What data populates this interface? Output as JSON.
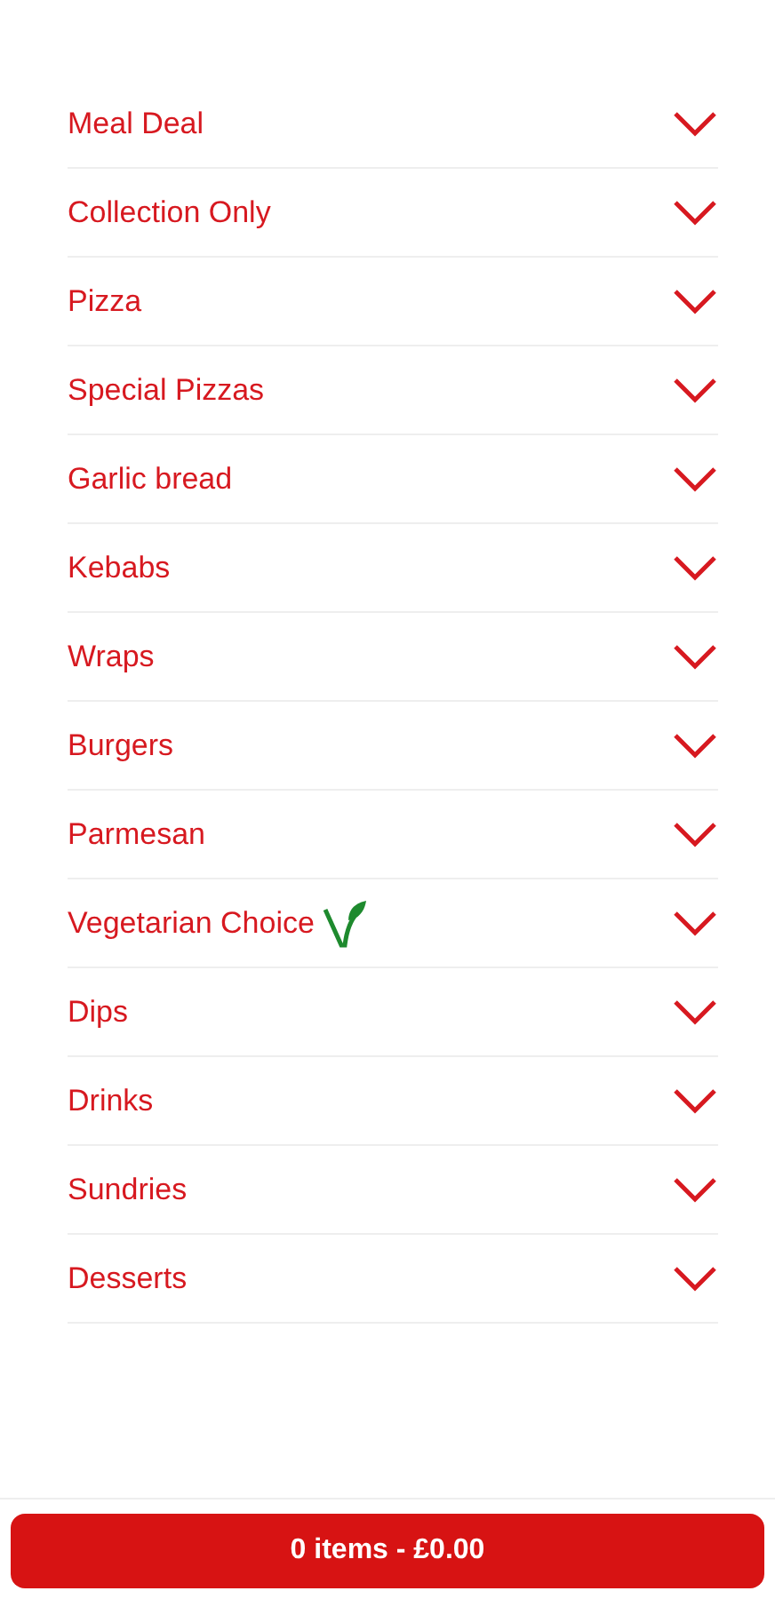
{
  "categories": [
    {
      "label": "Meal Deal",
      "vegetarian": false,
      "expanded": false
    },
    {
      "label": "Collection Only",
      "vegetarian": false,
      "expanded": false
    },
    {
      "label": "Pizza",
      "vegetarian": false,
      "expanded": false
    },
    {
      "label": "Special Pizzas",
      "vegetarian": false,
      "expanded": false
    },
    {
      "label": "Garlic bread",
      "vegetarian": false,
      "expanded": false
    },
    {
      "label": "Kebabs",
      "vegetarian": false,
      "expanded": false
    },
    {
      "label": "Wraps",
      "vegetarian": false,
      "expanded": false
    },
    {
      "label": "Burgers",
      "vegetarian": false,
      "expanded": false
    },
    {
      "label": "Parmesan",
      "vegetarian": false,
      "expanded": false
    },
    {
      "label": "Vegetarian Choice",
      "vegetarian": true,
      "expanded": false
    },
    {
      "label": "Dips",
      "vegetarian": false,
      "expanded": false
    },
    {
      "label": "Drinks",
      "vegetarian": false,
      "expanded": false
    },
    {
      "label": "Sundries",
      "vegetarian": false,
      "expanded": false
    },
    {
      "label": "Desserts",
      "vegetarian": false,
      "expanded": false
    }
  ],
  "basket": {
    "label": "0 items - £0.00"
  }
}
